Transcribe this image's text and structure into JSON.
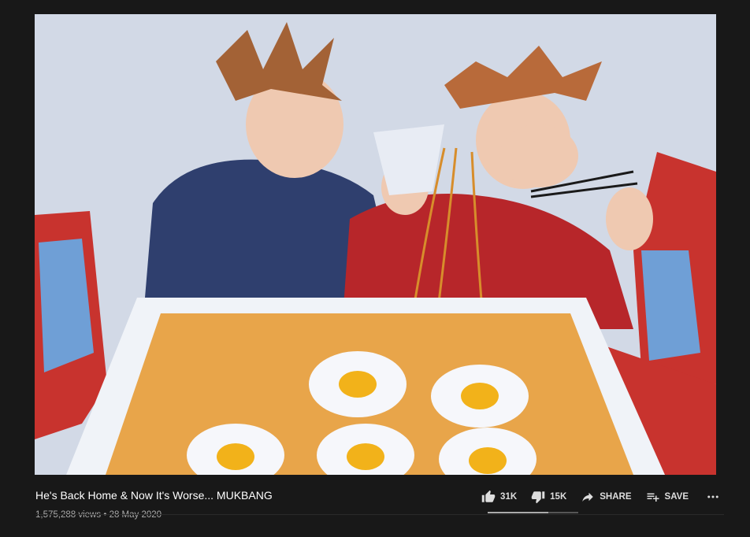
{
  "video": {
    "title": "He's Back Home & Now It's Worse... MUKBANG",
    "views": "1,575,288 views",
    "separator": "•",
    "date": "28 May 2020",
    "like_ratio": 0.67
  },
  "actions": {
    "like_count": "31K",
    "dislike_count": "15K",
    "share_label": "SHARE",
    "save_label": "SAVE"
  },
  "icons": {
    "like": "thumbs-up-icon",
    "dislike": "thumbs-down-icon",
    "share": "share-arrow-icon",
    "save": "playlist-add-icon",
    "more": "more-horizontal-icon"
  },
  "colors": {
    "background": "#181818",
    "text": "#ffffff",
    "meta_text": "#aaaaaa"
  }
}
